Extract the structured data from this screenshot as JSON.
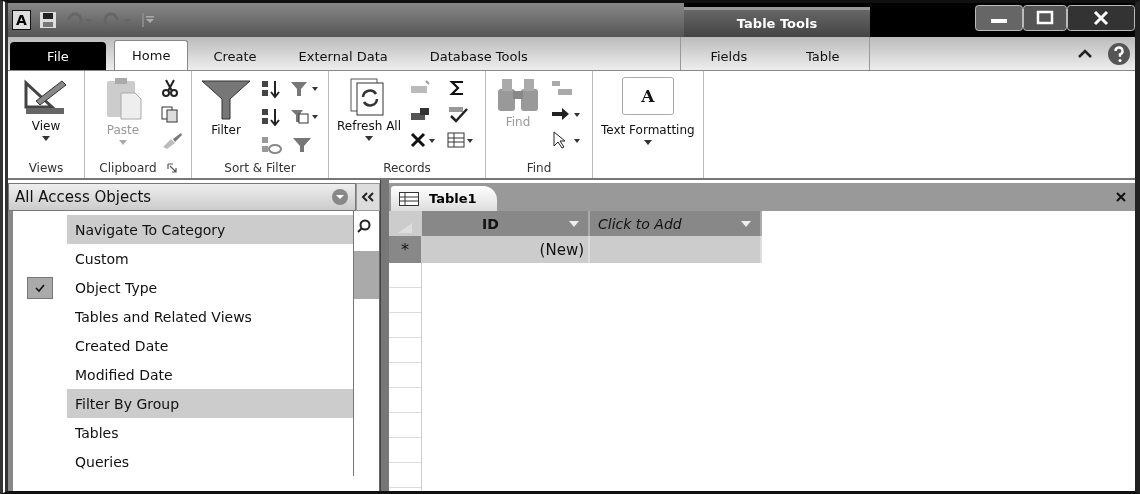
{
  "app_logo": "A",
  "contextual_tab_group": {
    "title": "Table Tools"
  },
  "tabs": [
    {
      "label": "File",
      "kind": "file",
      "selected": false
    },
    {
      "label": "Home",
      "kind": "normal",
      "selected": true
    },
    {
      "label": "Create",
      "kind": "normal",
      "selected": false
    },
    {
      "label": "External Data",
      "kind": "normal",
      "selected": false
    },
    {
      "label": "Database Tools",
      "kind": "normal",
      "selected": false
    }
  ],
  "contextual_tabs": [
    {
      "label": "Fields",
      "selected": false
    },
    {
      "label": "Table",
      "selected": false
    }
  ],
  "ribbon_groups": [
    {
      "kind": "views",
      "label": "Views",
      "button": {
        "label": "View",
        "disabled": false,
        "dropdown": true
      }
    },
    {
      "kind": "clipboard",
      "label": "Clipboard",
      "button": {
        "label": "Paste",
        "disabled": true,
        "dropdown": true
      }
    },
    {
      "kind": "sort",
      "label": "Sort & Filter",
      "button": {
        "label": "Filter",
        "disabled": false,
        "dropdown": false
      }
    },
    {
      "kind": "records",
      "label": "Records",
      "button": {
        "label": "Refresh All",
        "disabled": false,
        "dropdown": true
      }
    },
    {
      "kind": "find",
      "label": "Find",
      "button": {
        "label": "Find",
        "disabled": true,
        "dropdown": false
      }
    },
    {
      "kind": "text",
      "button": {
        "label": "Text Formatting",
        "disabled": false,
        "dropdown": true,
        "icon_text": "A"
      }
    }
  ],
  "navigation_pane": {
    "title": "All Access Objects"
  },
  "navigation_menu": [
    {
      "kind": "header",
      "label": "Navigate To Category"
    },
    {
      "kind": "item",
      "label": "Custom",
      "checked": false
    },
    {
      "kind": "item",
      "label": "Object Type",
      "checked": true
    },
    {
      "kind": "item",
      "label": "Tables and Related Views",
      "checked": false
    },
    {
      "kind": "item",
      "label": "Created Date",
      "checked": false
    },
    {
      "kind": "item",
      "label": "Modified Date",
      "checked": false
    },
    {
      "kind": "header",
      "label": "Filter By Group"
    },
    {
      "kind": "item",
      "label": "Tables",
      "checked": false
    },
    {
      "kind": "item",
      "label": "Queries",
      "checked": false
    }
  ],
  "document_tab": {
    "label": "Table1"
  },
  "table": {
    "columns": [
      {
        "label": "ID",
        "italic": false
      },
      {
        "label": "Click to Add",
        "italic": true
      }
    ],
    "rows": [
      {
        "marker": "*",
        "cells": [
          "(New)",
          ""
        ]
      }
    ]
  }
}
